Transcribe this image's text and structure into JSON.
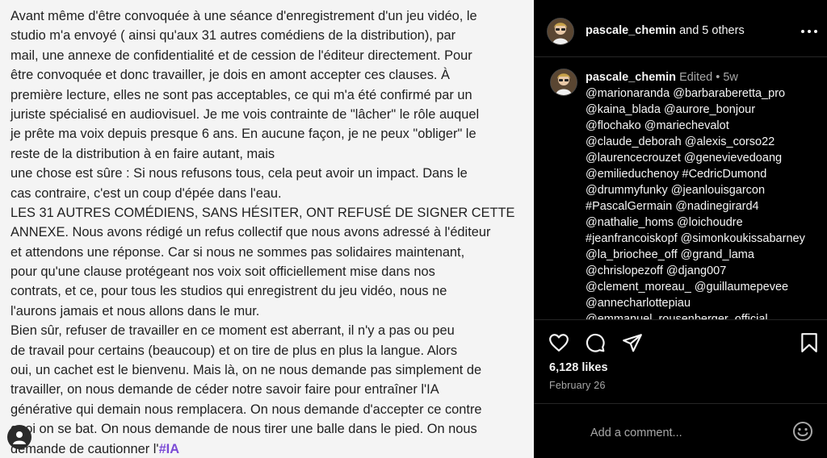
{
  "post_text": {
    "lines": [
      "Avant même d'être convoquée à une séance d'enregistrement d'un jeu vidéo, le",
      "studio m'a envoyé ( ainsi qu'aux 31 autres comédiens de la distribution), par",
      "mail, une annexe de confidentialité et de cession de l'éditeur directement. Pour",
      "être convoquée et donc travailler, je dois en amont accepter ces clauses. À",
      "première lecture, elles ne sont pas acceptables, ce qui m'a été confirmé par un",
      "juriste spécialisé en audiovisuel. Je me vois contrainte de \"lâcher\" le rôle auquel",
      "je prête ma voix depuis presque 6 ans. En aucune façon, je ne peux \"obliger\" le",
      "reste de la distribution à en faire autant, mais",
      "une chose est sûre : Si nous refusons tous, cela peut avoir un impact. Dans le",
      "cas contraire, c'est un coup d'épée dans l'eau.",
      "LES 31 AUTRES COMÉDIENS, SANS HÉSITER, ONT REFUSÉ DE SIGNER CETTE",
      "ANNEXE. Nous avons rédigé un refus collectif que nous avons adressé à l'éditeur",
      "et attendons une réponse. Car si nous ne sommes pas solidaires maintenant,",
      "pour qu'une clause protégeant nos voix soit officiellement mise dans nos",
      "contrats, et ce, pour tous les studios qui enregistrent du jeu vidéo, nous ne",
      "l'aurons jamais et nous allons dans le mur.",
      "Bien sûr, refuser de travailler en ce moment est aberrant, il n'y a pas ou peu",
      "de travail pour certains (beaucoup) et on tire de plus en plus la langue. Alors",
      "oui, un cachet est le bienvenu. Mais là, on ne nous demande pas simplement de",
      "travailler, on nous demande de céder notre savoir faire pour entraîner l'IA",
      "générative qui demain nous remplacera. On nous demande d'accepter ce contre",
      "quoi on se bat. On nous demande de nous tirer une balle dans le pied. On nous"
    ],
    "last_line_prefix": "demande de cautionner l'",
    "last_line_hashtag": "#IA"
  },
  "header": {
    "username": "pascale_chemin",
    "and_others": " and 5 others",
    "more_icon": "more-horizontal-icon"
  },
  "caption": {
    "username": "pascale_chemin",
    "edited": "Edited",
    "separator": " • ",
    "age": "5w",
    "first_line": "@marionaranda @barbaraberetta_pro",
    "lines": [
      "@kaina_blada @aurore_bonjour",
      "@flochako @mariechevalot",
      "@claude_deborah @alexis_corso22",
      "@laurencecrouzet @genevievedoang",
      "@emilieduchenoy #CedricDumond",
      "@drummyfunky @jeanlouisgarcon",
      "#PascalGermain @nadinegirard4",
      "@nathalie_homs @loichoudre",
      "#jeanfrancoiskopf @simonkoukissabarney",
      "@la_briochee_off @grand_lama",
      "@chrislopezoff @djang007",
      "@clement_moreau_ @guillaumepevee",
      "@annecharlottepiau",
      "@emmanuel_rousenberger_official"
    ]
  },
  "actions": {
    "icons": [
      "heart-icon",
      "comment-icon",
      "share-icon",
      "bookmark-icon"
    ]
  },
  "likes": "6,128 likes",
  "date": "February 26",
  "comment": {
    "placeholder": "Add a comment...",
    "emoji_icon": "emoji-icon"
  },
  "colors": {
    "panel_bg": "#000000",
    "text_bg": "#f4f4f4",
    "hashtag": "#7b4bd6",
    "muted": "#a8a8a8"
  }
}
